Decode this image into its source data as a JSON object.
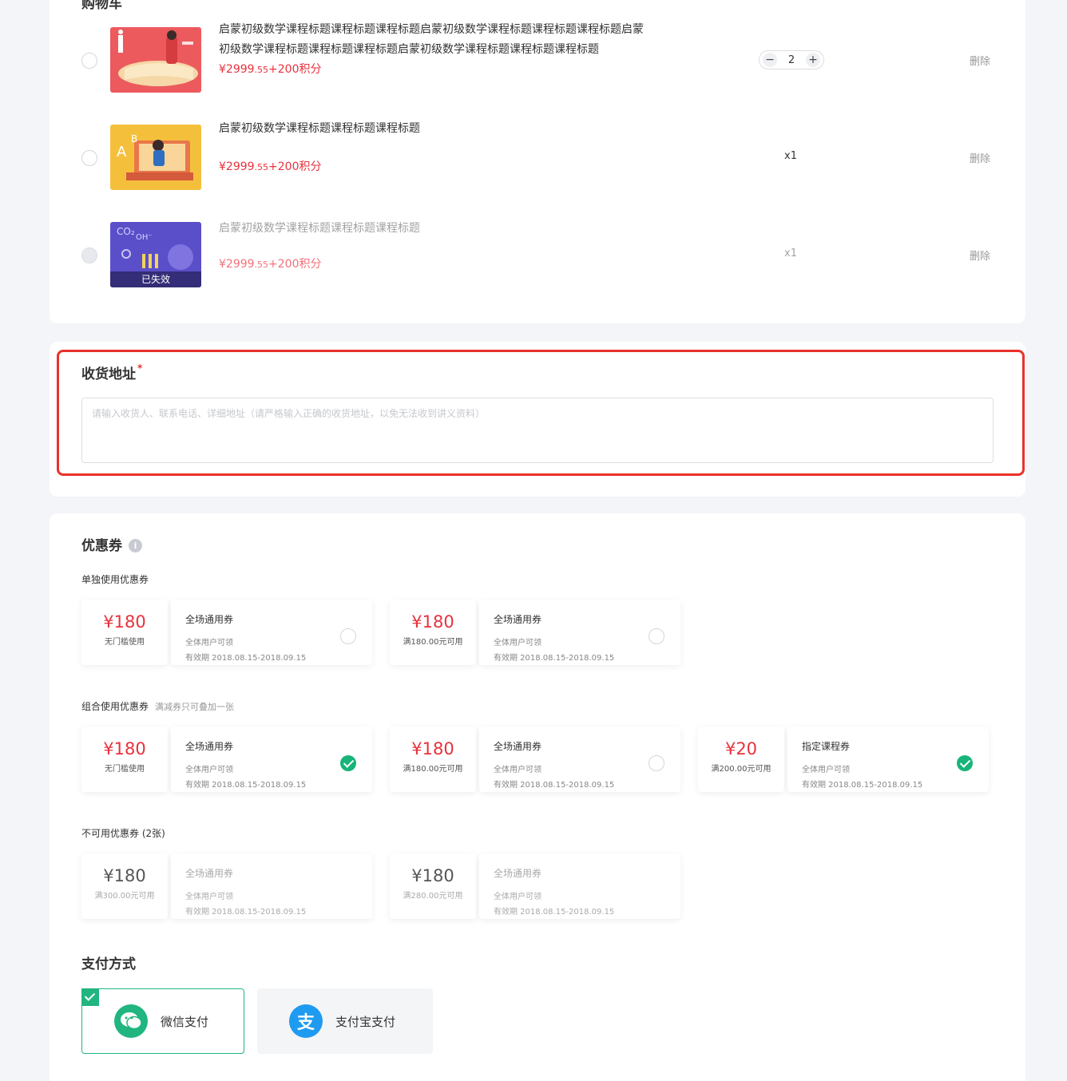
{
  "cart": {
    "title": "购物车",
    "items": [
      {
        "title": "启蒙初级数学课程标题课程标题课程标题启蒙初级数学课程标题课程标题课程标题启蒙初级数学课程标题课程标题课程标题启蒙初级数学课程标题课程标题课程标题",
        "price_main": "¥2999",
        "price_sub": ".55",
        "price_points": "+200积分",
        "quantity": "2",
        "delete_label": "删除"
      },
      {
        "title": "启蒙初级数学课程标题课程标题课程标题",
        "price_main": "¥2999",
        "price_sub": ".55",
        "price_points": "+200积分",
        "quantity": "x1",
        "delete_label": "删除"
      },
      {
        "title": "启蒙初级数学课程标题课程标题课程标题",
        "price_main": "¥2999",
        "price_sub": ".55",
        "price_points": "+200积分",
        "quantity": "x1",
        "delete_label": "删除",
        "thumb_badge": "已失效"
      }
    ],
    "stepper_minus": "−",
    "stepper_plus": "+"
  },
  "address": {
    "title": "收货地址",
    "required_mark": "*",
    "placeholder": "请输入收货人、联系电话、详细地址（请严格输入正确的收货地址，以免无法收到讲义资料）"
  },
  "coupon": {
    "title": "优惠券",
    "info_icon": "i",
    "single_title": "单独使用优惠券",
    "combo_title": "组合使用优惠券",
    "combo_note": "满减券只可叠加一张",
    "unavailable_title": "不可用优惠券 (2张)",
    "single": [
      {
        "amount": "¥180",
        "cond": "无门槛使用",
        "name": "全场通用券",
        "scope": "全体用户可领",
        "valid": "有效期 2018.08.15-2018.09.15"
      },
      {
        "amount": "¥180",
        "cond": "满180.00元可用",
        "name": "全场通用券",
        "scope": "全体用户可领",
        "valid": "有效期 2018.08.15-2018.09.15"
      }
    ],
    "combo": [
      {
        "amount": "¥180",
        "cond": "无门槛使用",
        "name": "全场通用券",
        "scope": "全体用户可领",
        "valid": "有效期 2018.08.15-2018.09.15"
      },
      {
        "amount": "¥180",
        "cond": "满180.00元可用",
        "name": "全场通用券",
        "scope": "全体用户可领",
        "valid": "有效期 2018.08.15-2018.09.15"
      },
      {
        "amount": "¥20",
        "cond": "满200.00元可用",
        "name": "指定课程券",
        "scope": "全体用户可领",
        "valid": "有效期 2018.08.15-2018.09.15"
      }
    ],
    "unavailable": [
      {
        "amount": "¥180",
        "cond": "满300.00元可用",
        "name": "全场通用券",
        "scope": "全体用户可领",
        "valid": "有效期 2018.08.15-2018.09.15"
      },
      {
        "amount": "¥180",
        "cond": "满280.00元可用",
        "name": "全场通用券",
        "scope": "全体用户可领",
        "valid": "有效期 2018.08.15-2018.09.15"
      }
    ]
  },
  "payment": {
    "title": "支付方式",
    "wechat_label": "微信支付",
    "alipay_label": "支付宝支付",
    "alipay_glyph": "支"
  },
  "colors": {
    "price_red": "#e8313d",
    "highlight_border": "#e8322a",
    "selected_green": "#18b47a",
    "wechat_green": "#21b580",
    "alipay_blue": "#1e9bf0"
  }
}
